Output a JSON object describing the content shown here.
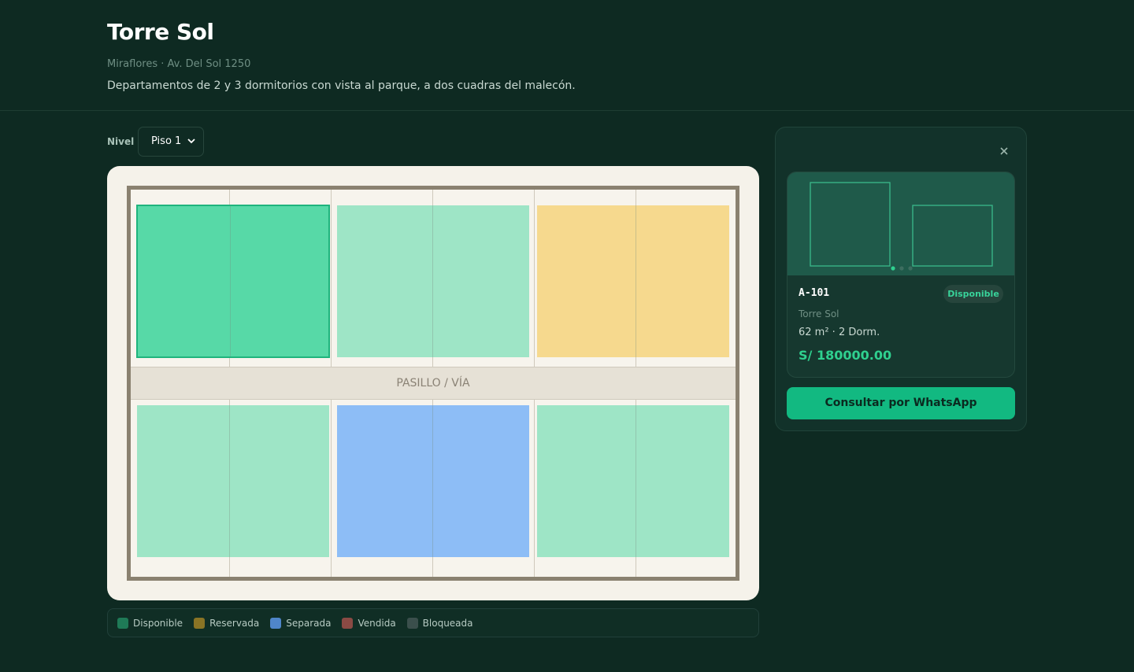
{
  "project": {
    "title": "Torre Sol",
    "subtitle": "Miraflores · Av. Del Sol 1250",
    "description": "Departamentos de 2 y 3 dormitorios con vista al parque, a dos cuadras del malecón."
  },
  "level": {
    "label": "Nivel",
    "selected": "Piso 1"
  },
  "map": {
    "corridor_label": "PASILLO / VÍA",
    "units": [
      {
        "status": "selected",
        "color": "#57d9a7"
      },
      {
        "status": "disponible",
        "color": "#9ee5c6"
      },
      {
        "status": "reservada",
        "color": "#f6d98e"
      },
      {
        "status": "disponible",
        "color": "#9ee5c6"
      },
      {
        "status": "separada",
        "color": "#8dbdf6"
      },
      {
        "status": "disponible",
        "color": "#9ee5c6"
      }
    ]
  },
  "legend": [
    {
      "label": "Disponible",
      "color": "#1f7a57"
    },
    {
      "label": "Reservada",
      "color": "#8a7425"
    },
    {
      "label": "Separada",
      "color": "#4f86c9"
    },
    {
      "label": "Vendida",
      "color": "#8a4a44"
    },
    {
      "label": "Bloqueada",
      "color": "#3b4f4c"
    }
  ],
  "panel": {
    "close_icon": "close-icon",
    "unit_code": "A-101",
    "status": "Disponible",
    "tower": "Torre Sol",
    "specs": "62 m² · 2 Dorm.",
    "price": "S/ 180000.00",
    "cta": "Consultar por WhatsApp"
  }
}
